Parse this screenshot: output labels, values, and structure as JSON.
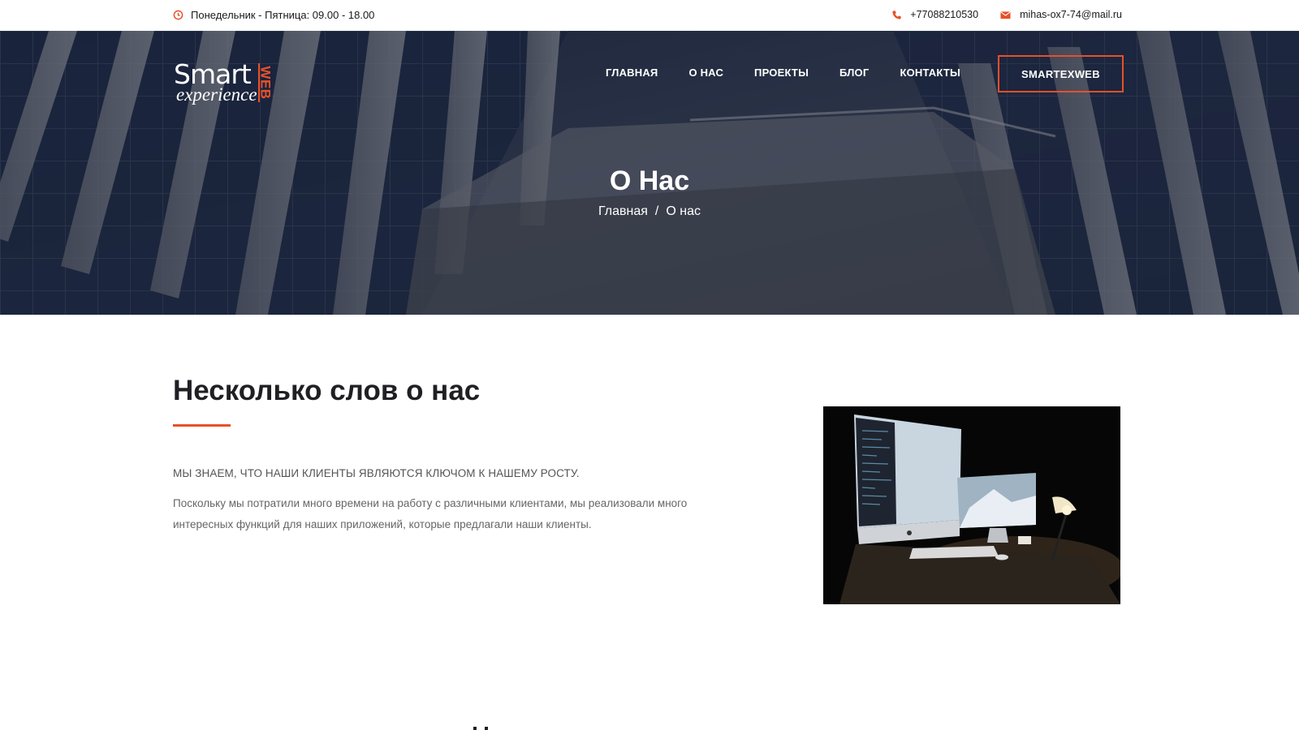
{
  "topbar": {
    "hours": "Понедельник - Пятница: 09.00 - 18.00",
    "phone": "+77088210530",
    "email": "mihas-ox7-74@mail.ru",
    "icons": {
      "hours": "clock-icon",
      "phone": "phone-icon",
      "email": "envelope-icon"
    }
  },
  "logo": {
    "word1": "Smart",
    "word2": "experience",
    "word3": "WEB"
  },
  "nav": {
    "items": [
      {
        "label": "ГЛАВНАЯ"
      },
      {
        "label": "О НАС"
      },
      {
        "label": "ПРОЕКТЫ"
      },
      {
        "label": "БЛОГ"
      },
      {
        "label": "КОНТАКТЫ"
      }
    ],
    "cta_label": "SMARTEXWEB"
  },
  "hero": {
    "title": "О Нас",
    "breadcrumb": {
      "home": "Главная",
      "separator": "/",
      "current": "О нас"
    }
  },
  "about": {
    "title": "Несколько слов о нас",
    "lead": "МЫ ЗНАЕМ, ЧТО НАШИ КЛИЕНТЫ ЯВЛЯЮТСЯ КЛЮЧОМ К НАШЕМУ РОСТУ.",
    "text": "Поскольку мы потратили много времени на работу с различными клиентами, мы реализовали много интересных функций для наших приложений, которые предлагали наши клиенты."
  },
  "colors": {
    "accent": "#e8502a",
    "heading": "#1f1f24",
    "body_text": "#666666"
  }
}
